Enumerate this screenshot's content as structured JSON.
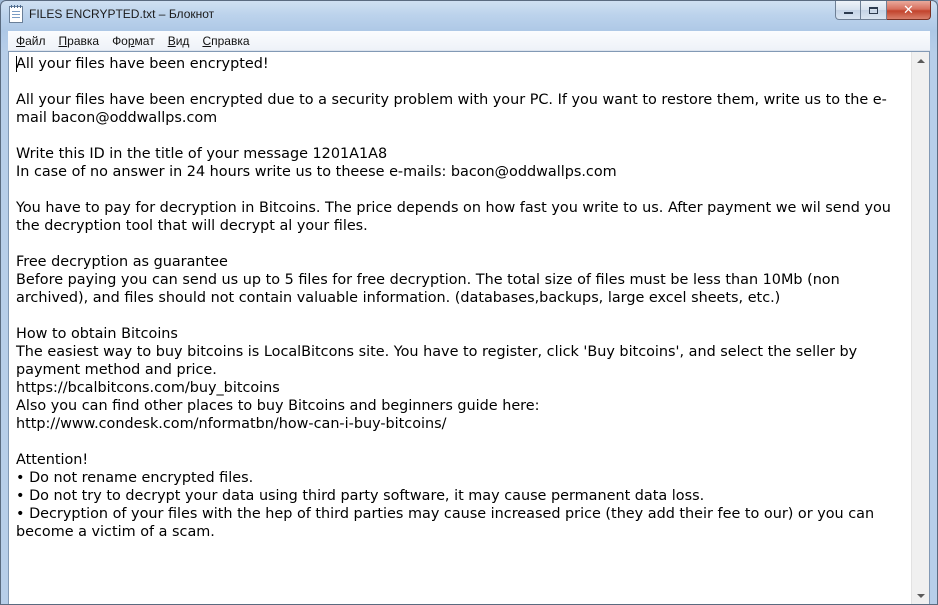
{
  "window": {
    "title": "FILES ENCRYPTED.txt – Блокнот",
    "buttons": {
      "minimize": "–",
      "maximize": "□",
      "close": "✕"
    }
  },
  "menu": {
    "items": [
      {
        "accel": "Ф",
        "rest": "айл"
      },
      {
        "accel": "П",
        "rest": "равка"
      },
      {
        "accel": "",
        "pre": "Фо",
        "accel2": "р",
        "rest": "мат"
      },
      {
        "accel": "В",
        "rest": "ид"
      },
      {
        "accel": "С",
        "rest": "правка"
      }
    ]
  },
  "document": {
    "text": "All your files have been encrypted!\n\nAll your files have been encrypted due to a security problem with your PC. If you want to restore them, write us to the e-mail bacon@oddwallps.com\n\nWrite this ID in the title of your message 1201A1A8\nIn case of no answer in 24 hours write us to theese e-mails: bacon@oddwallps.com\n\nYou have to pay for decryption in Bitcoins. The price depends on how fast you write to us. After payment we wil send you the decryption tool that will decrypt al your files.\n\nFree decryption as guarantee\nBefore paying you can send us up to 5 files for free decryption. The total size of files must be less than 10Mb (non archived), and files should not contain valuable information. (databases,backups, large excel sheets, etc.)\n\nHow to obtain Bitcoins\nThe easiest way to buy bitcoins is LocalBitcons site. You have to register, click 'Buy bitcoins', and select the seller by payment method and price.\nhttps://bcalbitcons.com/buy_bitcoins\nAlso you can find other places to buy Bitcoins and beginners guide here:\nhttp://www.condesk.com/nformatbn/how-can-i-buy-bitcoins/\n\nAttention!\n• Do not rename encrypted files.\n• Do not try to decrypt your data using third party software, it may cause permanent data loss.\n• Decryption of your files with the hep of third parties may cause increased price (they add their fee to our) or you can become a victim of a scam."
  },
  "icons": {
    "app": "notepad-icon",
    "scroll_up": "arrow-up-icon",
    "scroll_down": "arrow-down-icon"
  }
}
